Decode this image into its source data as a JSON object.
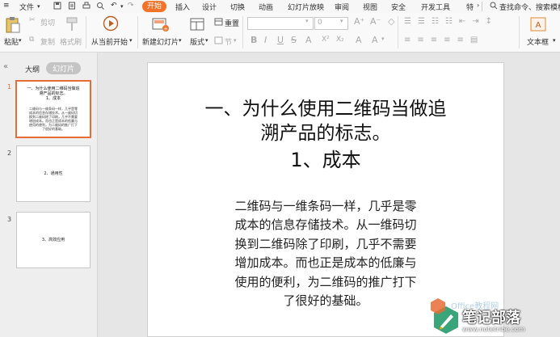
{
  "menu": {
    "file": "文件",
    "tabs": [
      "开始",
      "插入",
      "设计",
      "切换",
      "动画",
      "幻灯片放映",
      "审阅",
      "视图",
      "安全",
      "开发工具",
      "特"
    ],
    "search": "查找命令、搜索模板"
  },
  "ribbon": {
    "paste": "粘贴",
    "cut": "剪切",
    "copy": "复制",
    "format_painter": "格式刷",
    "play_from_current": "从当前开始",
    "new_slide": "新建幻灯片",
    "layout": "版式",
    "reset": "重置",
    "section": "节",
    "font_size": "0",
    "textbox": "文本框",
    "style_letters": [
      "B",
      "I",
      "U",
      "S",
      "A",
      "X²",
      "X₂",
      "A",
      "A"
    ]
  },
  "panel": {
    "outline_tab": "大纲",
    "slides_tab": "幻灯片"
  },
  "thumbnails": [
    {
      "num": "1",
      "lines": [
        "一、为什么使用二维码当做追",
        "溯产品的标志。",
        "1、成本"
      ],
      "body": [
        "二维码与一维条码一样，几乎是零",
        "成本的信息存储技术。从一维码切",
        "换到二维码除了印刷，几乎不需要",
        "增加成本。而也正是成本的低廉与",
        "使用的便利，为二维码的推广打下",
        "了很好的基础。"
      ]
    },
    {
      "num": "2",
      "lines": [
        "2、通用性"
      ],
      "body": []
    },
    {
      "num": "3",
      "lines": [
        "3、高效应用"
      ],
      "body": []
    }
  ],
  "slide": {
    "title_lines": [
      "一、为什么使用二维码当做追",
      "溯产品的标志。",
      "1、成本"
    ],
    "body_lines": [
      "二维码与一维条码一样，几乎是零",
      "成本的信息存储技术。从一维码切",
      "换到二维码除了印刷，几乎不需要",
      "增加成本。而也正是成本的低廉与",
      "使用的便利，为二维码的推广打下",
      "了很好的基础。"
    ]
  },
  "watermark": {
    "title": "笔记部落",
    "url": "www.notetribe.com",
    "faded": "Office教程网"
  },
  "colors": {
    "accent": "#f4732a",
    "selected_thumb": "#e86c35"
  }
}
